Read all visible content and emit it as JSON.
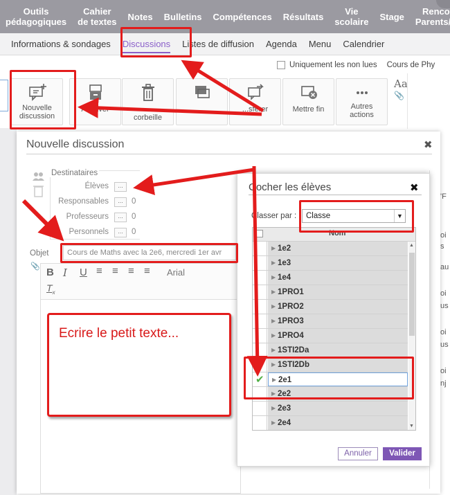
{
  "topnav": {
    "items": [
      "Outils\npédagogiques",
      "Cahier\nde textes",
      "Notes",
      "Bulletins",
      "Compétences",
      "Résultats",
      "Vie\nscolaire",
      "Stage",
      "Renco\nParents/P"
    ]
  },
  "subnav": {
    "items": [
      "Informations & sondages",
      "Discussions",
      "Listes de diffusion",
      "Agenda",
      "Menu",
      "Calendrier"
    ],
    "active_index": 1
  },
  "filter": {
    "unread_label": "Uniquement les non lues",
    "course_label": "Cours de Phy"
  },
  "toolbar": {
    "buttons": [
      {
        "label": "Nouvelle\ndiscussion",
        "icon": "new-discussion-icon"
      },
      {
        "label": "Archiver",
        "icon": "archive-icon"
      },
      {
        "label": "...\ncorbeille",
        "icon": "trash-icon"
      },
      {
        "label": "",
        "icon": "copy-icon"
      },
      {
        "label": "...sférer",
        "icon": "transfer-icon"
      },
      {
        "label": "Mettre fin",
        "icon": "end-discussion-icon"
      },
      {
        "label": "Autres\nactions",
        "icon": "more-icon"
      }
    ],
    "aa_label": "Aa"
  },
  "dialog": {
    "title": "Nouvelle discussion",
    "close_glyph": "✖",
    "destinataires_label": "Destinataires",
    "rows": [
      {
        "label": "Élèves",
        "count": ""
      },
      {
        "label": "Responsables",
        "count": "0"
      },
      {
        "label": "Professeurs",
        "count": "0"
      },
      {
        "label": "Personnels",
        "count": "0"
      }
    ],
    "objet_label": "Objet",
    "objet_value": "Cours de Maths avec la 2e6, mercredi 1er avr",
    "font_name": "Arial"
  },
  "popup": {
    "title": "Cocher les élèves",
    "sort_label": "Classer par :",
    "sort_value": "Classe",
    "column_name": "Nom",
    "classes": [
      "1e2",
      "1e3",
      "1e4",
      "1PRO1",
      "1PRO2",
      "1PRO3",
      "1PRO4",
      "1STI2Da",
      "1STI2Db",
      "2e1",
      "2e2",
      "2e3",
      "2e4"
    ],
    "selected_class": "2e1",
    "cancel_label": "Annuler",
    "validate_label": "Valider"
  },
  "annotation": {
    "text": "Ecrire le petit texte...",
    "color": "#e31c1c"
  },
  "colors": {
    "nav_bg": "#9b9aa1",
    "accent": "#8a5fc9",
    "validate_bg": "#7e57b5",
    "check": "#51b046"
  }
}
